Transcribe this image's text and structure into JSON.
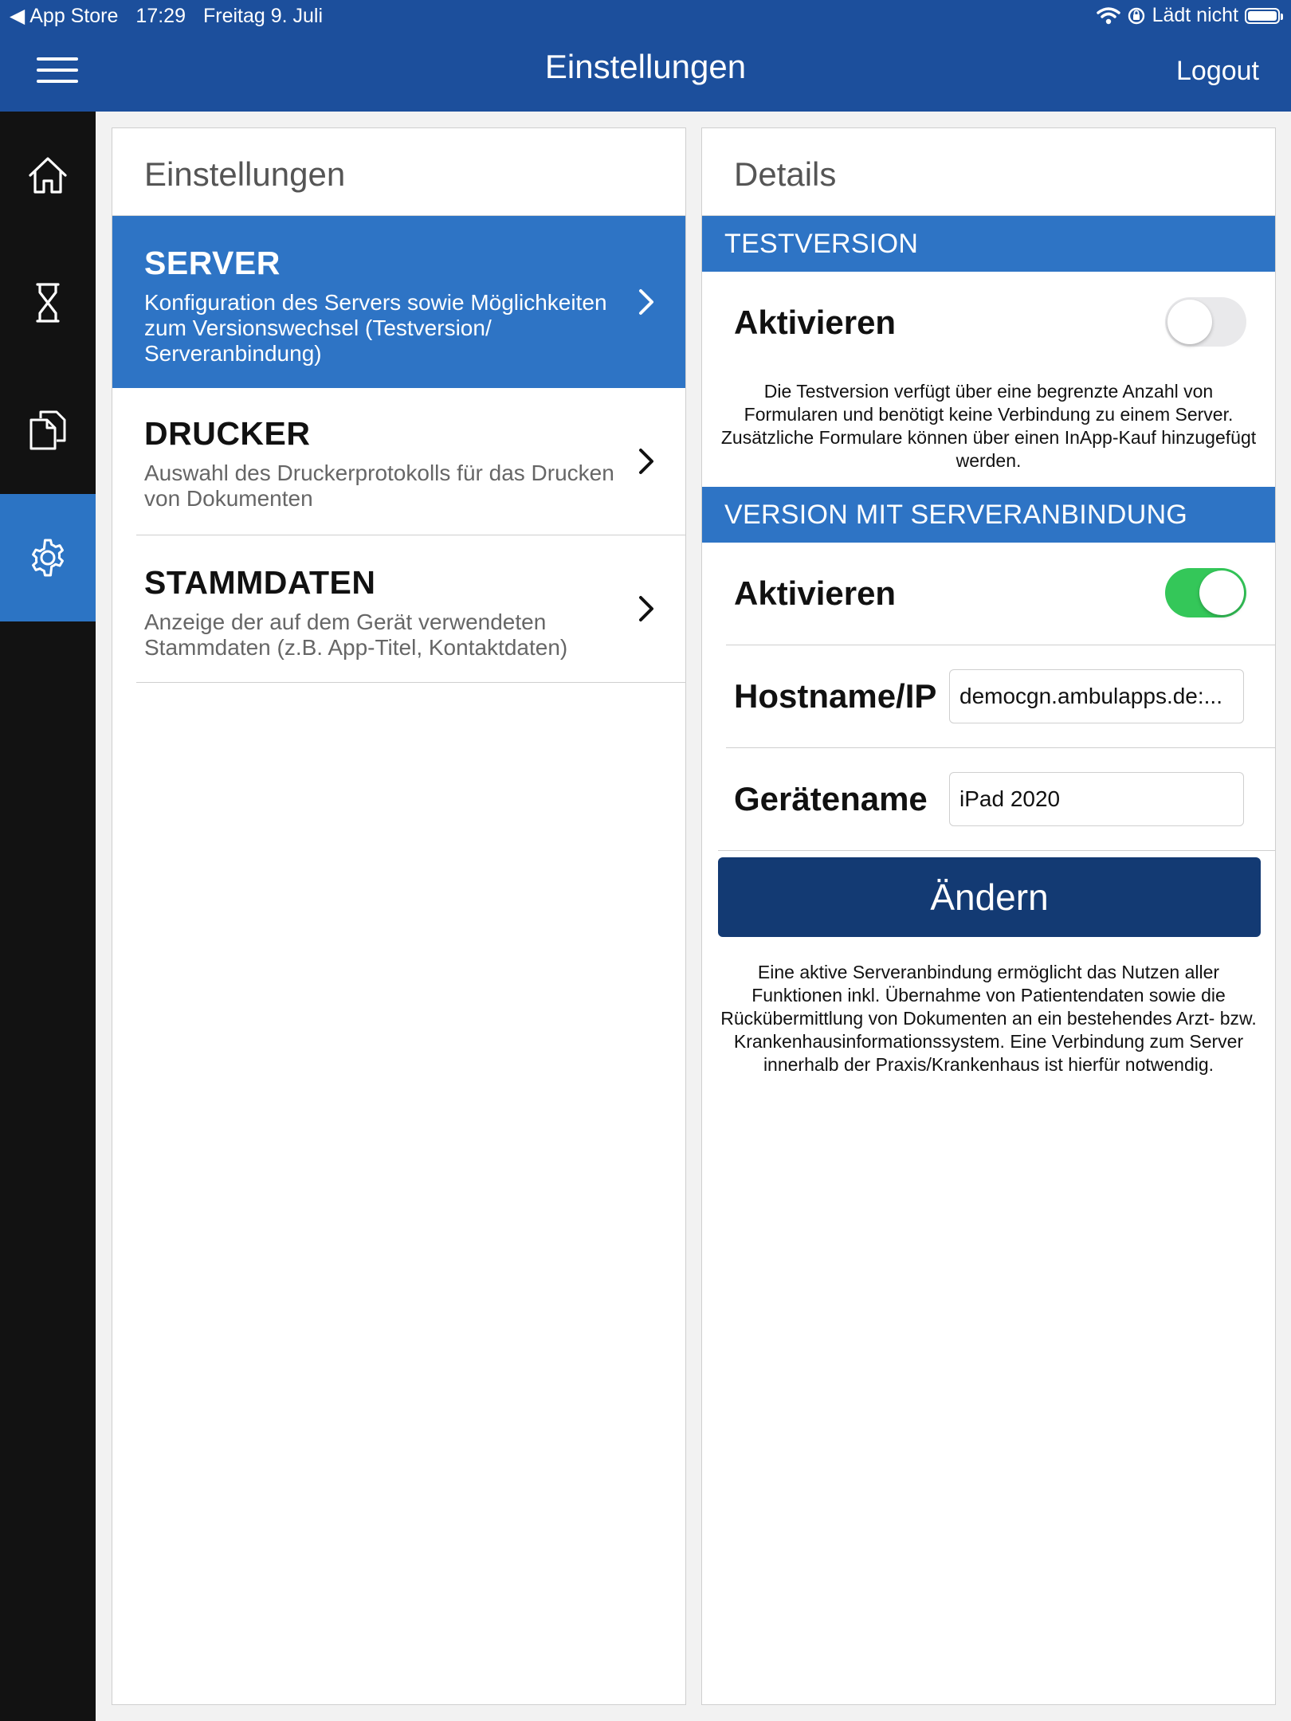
{
  "status_bar": {
    "back_app": "App Store",
    "time": "17:29",
    "date": "Freitag 9. Juli",
    "charging": "Lädt nicht"
  },
  "header": {
    "title": "Einstellungen",
    "logout": "Logout"
  },
  "sidenav": {
    "items": [
      {
        "icon": "home-icon",
        "active": false
      },
      {
        "icon": "hourglass-icon",
        "active": false
      },
      {
        "icon": "documents-icon",
        "active": false
      },
      {
        "icon": "gear-icon",
        "active": true
      }
    ]
  },
  "settings": {
    "title": "Einstellungen",
    "items": [
      {
        "title": "SERVER",
        "subtitle": "Konfiguration des Servers sowie Möglichkeiten zum Versionswechsel (Testversion/ Serveranbindung)"
      },
      {
        "title": "DRUCKER",
        "subtitle": "Auswahl des Druckerprotokolls für das Drucken von Dokumenten"
      },
      {
        "title": "STAMMDATEN",
        "subtitle": "Anzeige der auf dem Gerät verwendeten Stammdaten (z.B. App-Titel, Kontaktdaten)"
      }
    ]
  },
  "details": {
    "title": "Details",
    "test": {
      "header": "TESTVERSION",
      "activate_label": "Aktivieren",
      "enabled": false,
      "description": "Die Testversion verfügt über eine begrenzte Anzahl von Formularen und benötigt keine Verbindung zu einem Server. Zusätzliche Formulare können über einen InApp-Kauf hinzugefügt werden."
    },
    "server": {
      "header": "VERSION MIT SERVERANBINDUNG",
      "activate_label": "Aktivieren",
      "enabled": true,
      "hostname_label": "Hostname/IP",
      "hostname_value": "democgn.ambulapps.de:...",
      "device_label": "Gerätename",
      "device_value": "iPad 2020",
      "change_button": "Ändern",
      "description": "Eine aktive Serveranbindung ermöglicht das Nutzen aller Funktionen inkl. Übernahme von Patientendaten sowie die Rückübermittlung von Dokumenten an ein bestehendes Arzt- bzw. Krankenhausinformationssystem. Eine Verbindung zum Server innerhalb der Praxis/Krankenhaus ist hierfür notwendig."
    }
  },
  "colors": {
    "header_blue": "#1c4f9c",
    "accent_blue": "#2e74c5",
    "button_navy": "#133a73",
    "toggle_on": "#34c759"
  }
}
